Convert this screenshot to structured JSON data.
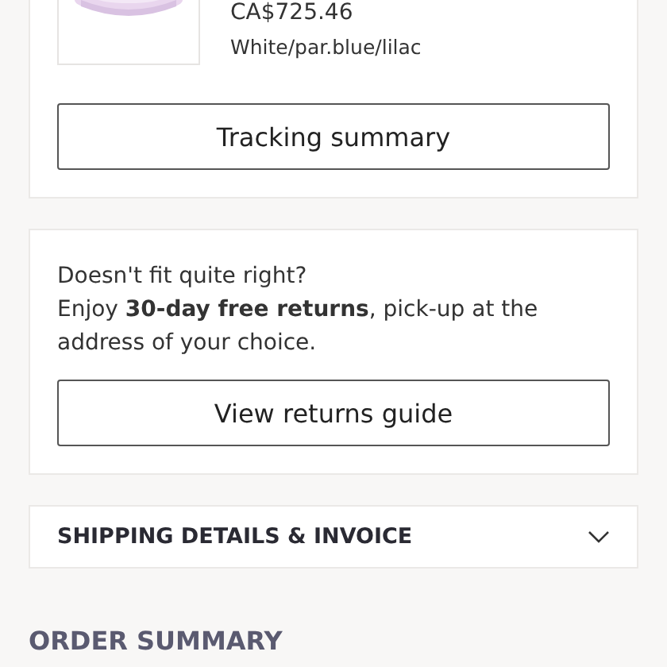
{
  "order_item": {
    "price": "CA$725.46",
    "variant": "White/par.blue/lilac"
  },
  "tracking_button": "Tracking summary",
  "returns": {
    "question": "Doesn't fit quite right?",
    "text": "Enjoy **30-day free returns**, pick-up at the address of your choice.",
    "button": "View returns guide"
  },
  "accordion": {
    "title": "SHIPPING DETAILS & INVOICE",
    "expanded": false
  },
  "order_summary": {
    "title": "ORDER SUMMARY"
  }
}
